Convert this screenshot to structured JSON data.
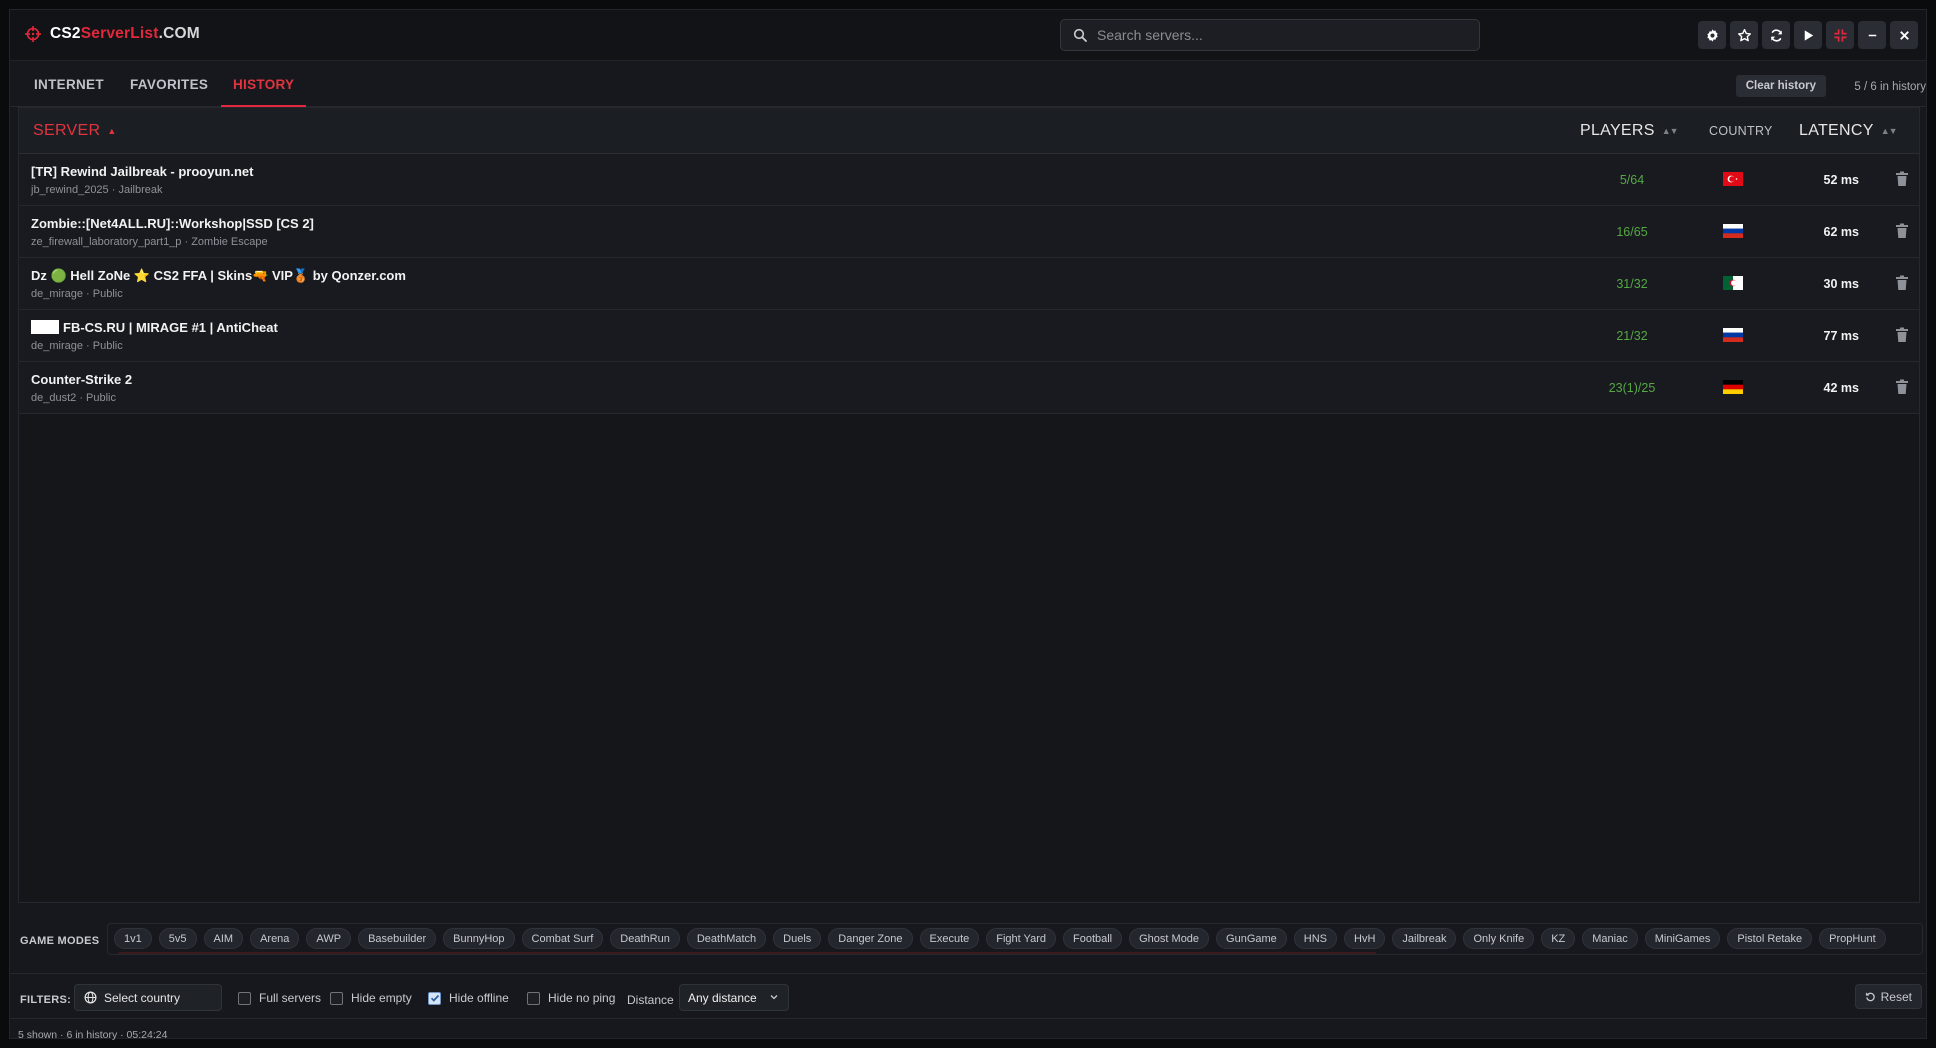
{
  "app": {
    "logo_part1": "CS2",
    "logo_part2": "ServerList",
    "logo_part3": ".COM"
  },
  "search": {
    "placeholder": "Search servers..."
  },
  "window_buttons": [
    {
      "icon": "gear-icon"
    },
    {
      "icon": "star-icon"
    },
    {
      "icon": "refresh-icon"
    },
    {
      "icon": "play-icon"
    },
    {
      "icon": "collapse-icon"
    },
    {
      "icon": "minimize-icon"
    },
    {
      "icon": "close-icon"
    }
  ],
  "tabs": [
    {
      "label": "INTERNET",
      "active": false
    },
    {
      "label": "FAVORITES",
      "active": false
    },
    {
      "label": "HISTORY",
      "active": true
    }
  ],
  "history": {
    "clear_label": "Clear history",
    "count_text": "5 / 6 in history"
  },
  "columns": {
    "server": "SERVER",
    "players": "PLAYERS",
    "country": "COUNTRY",
    "latency": "LATENCY"
  },
  "rows": [
    {
      "name": "[TR] Rewind Jailbreak - prooyun.net",
      "sub": "jb_rewind_2025 · Jailbreak",
      "players": "5/64",
      "country": "TR",
      "ping": "52 ms"
    },
    {
      "name": "Zombie::[Net4ALL.RU]::Workshop|SSD [CS 2]",
      "sub": "ze_firewall_laboratory_part1_p · Zombie Escape",
      "players": "16/65",
      "country": "RU",
      "ping": "62 ms"
    },
    {
      "name": "Dz 🟢 Hell ZoNe ⭐ CS2 FFA | Skins🔫 VIP🥉 by Qonzer.com",
      "sub": "de_mirage · Public",
      "players": "31/32",
      "country": "DZ",
      "ping": "30 ms"
    },
    {
      "name": "FB-CS.RU | MIRAGE #1 | AntiCheat",
      "sub": "de_mirage · Public",
      "players": "21/32",
      "country": "RU",
      "ping": "77 ms"
    },
    {
      "name": "Counter-Strike 2",
      "sub": "de_dust2 · Public",
      "players": "23(1)/25",
      "country": "DE",
      "ping": "42 ms"
    }
  ],
  "game_modes": {
    "label": "GAME MODES",
    "items": [
      "1v1",
      "5v5",
      "AIM",
      "Arena",
      "AWP",
      "Basebuilder",
      "BunnyHop",
      "Combat Surf",
      "DeathRun",
      "DeathMatch",
      "Duels",
      "Danger Zone",
      "Execute",
      "Fight Yard",
      "Football",
      "Ghost Mode",
      "GunGame",
      "HNS",
      "HvH",
      "Jailbreak",
      "Only Knife",
      "KZ",
      "Maniac",
      "MiniGames",
      "Pistol Retake",
      "PropHunt"
    ]
  },
  "filters": {
    "label": "FILTERS:",
    "country_placeholder": "Select country",
    "full_servers": "Full servers",
    "hide_empty": "Hide empty",
    "hide_offline": "Hide offline",
    "hide_no_ping": "Hide no ping",
    "distance_label": "Distance",
    "distance_value": "Any distance",
    "reset_label": "Reset",
    "checked": {
      "full_servers": false,
      "hide_empty": false,
      "hide_offline": true,
      "hide_no_ping": false
    }
  },
  "status": {
    "text": "5 shown · 6 in history · 05:24:24"
  },
  "colors": {
    "accent": "#e2283a",
    "players": "#56a845",
    "background": "#16181d"
  }
}
